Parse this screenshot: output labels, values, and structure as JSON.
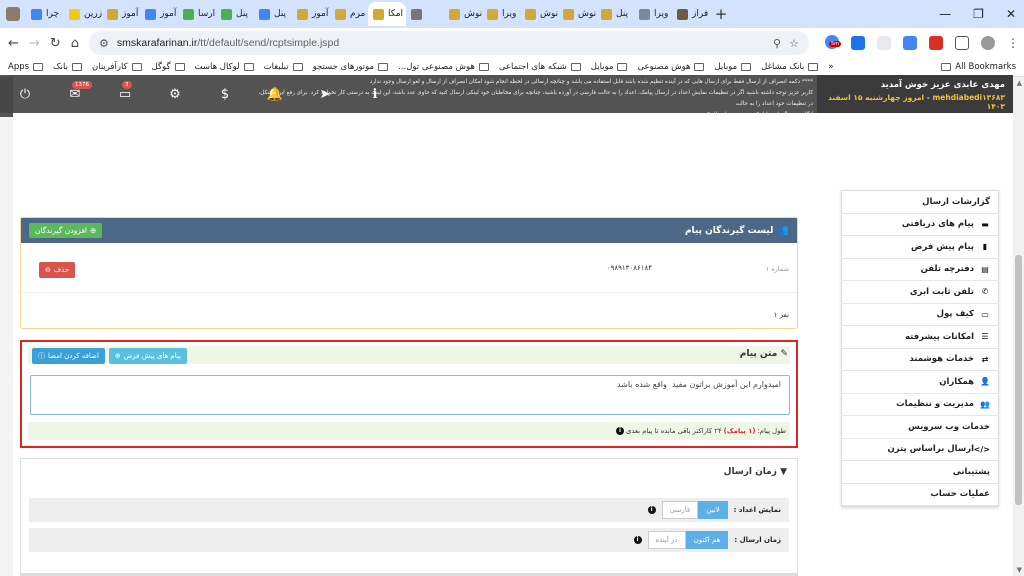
{
  "browser": {
    "tabs": [
      {
        "label": "فراز",
        "color": "#6b5b45"
      },
      {
        "label": "ویرا",
        "color": "#7a8a9a"
      },
      {
        "label": "پنل",
        "color": "#d4a838"
      },
      {
        "label": "نوش",
        "color": "#d4a838"
      },
      {
        "label": "نوش",
        "color": "#d4a838"
      },
      {
        "label": "ویرا",
        "color": "#d4a838"
      },
      {
        "label": "نوش",
        "color": "#d4a838"
      },
      {
        "label": "",
        "color": "#777777"
      },
      {
        "label": "امکا",
        "color": "#d4a838",
        "active": true
      },
      {
        "label": "مرم",
        "color": "#d4a838"
      },
      {
        "label": "آموز",
        "color": "#d4a838"
      },
      {
        "label": "پنل",
        "color": "#4285f4"
      },
      {
        "label": "پنل",
        "color": "#4caf50"
      },
      {
        "label": "ارسا",
        "color": "#4caf50"
      },
      {
        "label": "آموز",
        "color": "#4285f4"
      },
      {
        "label": "آموز",
        "color": "#d4a838"
      },
      {
        "label": "زرین",
        "color": "#f5c518"
      },
      {
        "label": "چرا",
        "color": "#4285f4"
      }
    ],
    "new_tab": "+",
    "url_host": "smskarafarinan.ir",
    "url_path": "/tt/default/send/rcptsimple.jspd",
    "ext_badge": "5m",
    "bookmarks": [
      "بانک مشاغل",
      "موبایل",
      "هوش مصنوعی",
      "موبایل",
      "شبکه های اجتماعی",
      "هوش مصنوعی تول...",
      "موتورهای جستجو",
      "تبلیغات",
      "لوکال هاست",
      "گوگل",
      "کارآفرینان",
      "بانک",
      "Apps"
    ],
    "all_bookmarks": "All Bookmarks"
  },
  "app": {
    "topbar_badges": {
      "mail": "1376",
      "cart": "3"
    },
    "notice_lines": [
      "**** دکمه انصراف از ارسال فقط برای ارسال هایی که در آینده تنظیم شده باشد قابل استفاده می باشد و چنانچه ارسالی در لحظه انجام شود امکان انصراف از ارسال و لغو ارسال وجود ندارد",
      "کاربر عزیز توجه داشته باشید اگر در تنظیمات نمایش اعداد در ارسال پیامک، اعداد را به حالت فارسی در آورده باشید، چنانچه برای مخاطبان خود لینکی ارسال کنید که حاوی عدد باشد، این لینک به درستی کار نخواهد کرد. برای رفع این مشکل، در تنظیمات خود اعداد را به حالت",
      "انگلیسی برگردانید یا لینکی بدون عدد ارسال کنید."
    ],
    "user": {
      "welcome": "مهدی عابدی عزیز خوش آمدید",
      "username_date": "mehdiabedi۱۳۶۸۳ - امروز چهارشنبه ۱۵ اسفند ۱۴۰۳"
    },
    "side_menu": [
      {
        "label": "گزارشات ارسال",
        "icon": ""
      },
      {
        "label": "پیام های دریافتی",
        "icon": "inbox-icon"
      },
      {
        "label": "پیام پیش فرض",
        "icon": "book-icon"
      },
      {
        "label": "دفترچه تلفن",
        "icon": "address-book-icon"
      },
      {
        "label": "تلفن ثابت ابری",
        "icon": "phone-icon"
      },
      {
        "label": "کیف پول",
        "icon": "wallet-icon"
      },
      {
        "label": "امکانات پیشرفته",
        "icon": "list-icon"
      },
      {
        "label": "خدمات هوشمند",
        "icon": "exchange-icon"
      },
      {
        "label": "همکاران",
        "icon": "user-icon"
      },
      {
        "label": "مدیریت و تنظیمات",
        "icon": "users-icon"
      },
      {
        "label": "خدمات وب سرویس",
        "icon": ""
      },
      {
        "label": "ارسال براساس پترن",
        "icon": "code-icon"
      },
      {
        "label": "پشتیبانی",
        "icon": ""
      },
      {
        "label": "عملیات حساب",
        "icon": ""
      }
    ],
    "recipients": {
      "title": "لیست گیرندگان پیام",
      "add_button": "افزودن گیرندگان",
      "row_number": "۱ شماره",
      "phone": "۰۹۸۹۱۳۰۸۶۱۸۴",
      "delete_button": "حذف",
      "count": "۱ نفر"
    },
    "message": {
      "title": "متن پیام",
      "default_msgs_button": "پیام های پیش فرض",
      "add_signature_button": "اضافه کردن امضا",
      "text": "امیدوارم این آموزش براتون مفید  واقع شده باشد",
      "length_label": "طول پیام:",
      "length_value": "(۱ پیامک)",
      "remaining": "۲۴ کاراکتر باقی مانده تا پیام بعدی"
    },
    "send_time": {
      "title": "زمان ارسال",
      "display_label": "نمایش اعداد :",
      "display_options": [
        "فارسی",
        "لاتین"
      ],
      "display_selected": "لاتین",
      "time_label": "زمان ارسال :",
      "time_options": [
        "در آینده",
        "هم اکنون"
      ],
      "time_selected": "هم اکنون"
    }
  }
}
